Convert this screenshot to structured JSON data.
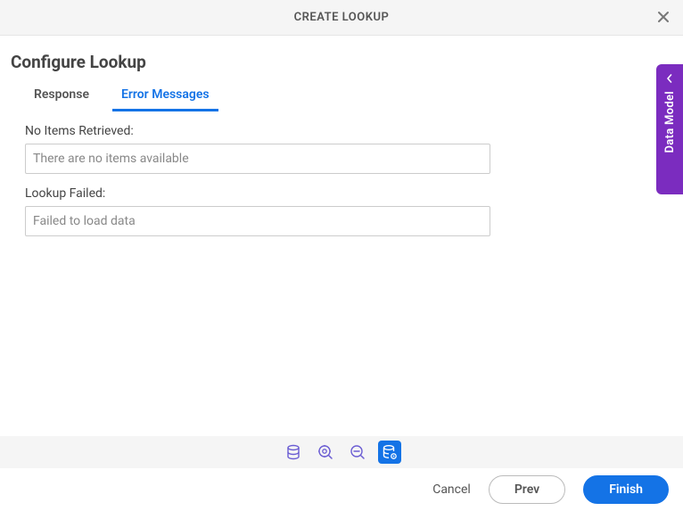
{
  "header": {
    "title": "CREATE LOOKUP"
  },
  "page": {
    "title": "Configure Lookup"
  },
  "tabs": [
    {
      "label": "Response",
      "active": false
    },
    {
      "label": "Error Messages",
      "active": true
    }
  ],
  "fields": {
    "noItems": {
      "label": "No Items Retrieved:",
      "value": "There are no items available"
    },
    "lookupFailed": {
      "label": "Lookup Failed:",
      "value": "Failed to load data"
    }
  },
  "sidePanel": {
    "label": "Data Model"
  },
  "wizardSteps": [
    {
      "name": "data-source",
      "active": false
    },
    {
      "name": "configure",
      "active": false
    },
    {
      "name": "search",
      "active": false
    },
    {
      "name": "lookup",
      "active": true
    }
  ],
  "footer": {
    "cancel": "Cancel",
    "prev": "Prev",
    "finish": "Finish"
  }
}
